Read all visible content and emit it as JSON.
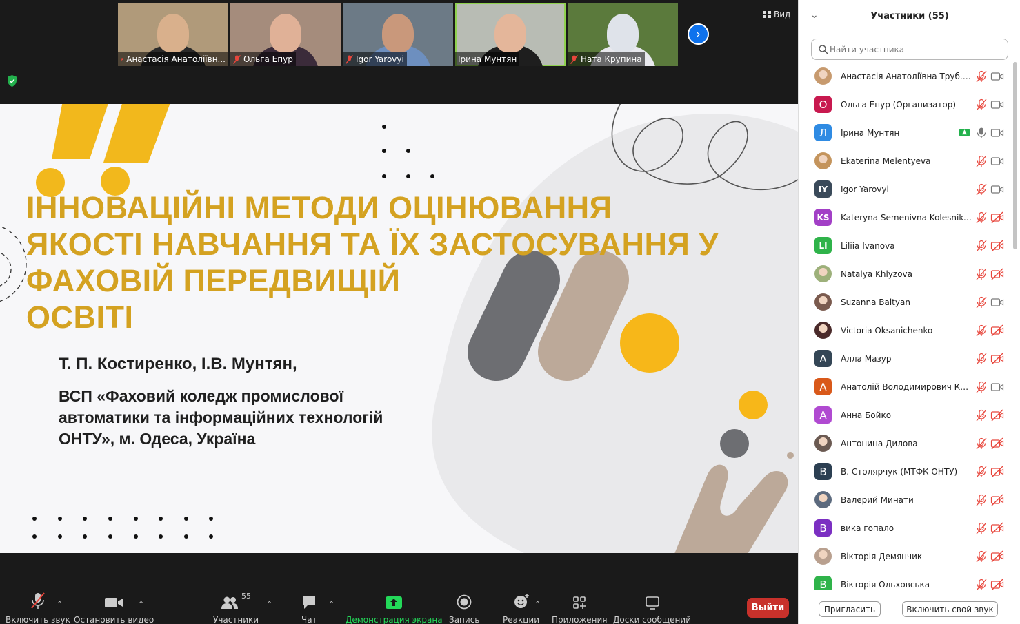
{
  "thumbnails": [
    {
      "name": "Анастасія Анатоліївн...",
      "muted": true,
      "bg": "#b09a7a",
      "face": "#d9b08c",
      "shirt": "#2a2a2a",
      "active": false
    },
    {
      "name": "Ольга Епур",
      "muted": true,
      "bg": "#a58c7c",
      "face": "#e0b197",
      "shirt": "#3b2b3a",
      "active": false
    },
    {
      "name": "Igor Yarovyi",
      "muted": true,
      "bg": "#6c7a86",
      "face": "#c9987b",
      "shirt": "#6d8fbf",
      "active": false
    },
    {
      "name": "Ірина Мунтян",
      "muted": false,
      "bg": "#b8bcb4",
      "face": "#e4b69a",
      "shirt": "#1e1e1e",
      "active": true
    },
    {
      "name": "Ната Крупина",
      "muted": true,
      "bg": "#5b7a3c",
      "face": "#dfe3ea",
      "shirt": "#e9e9ee",
      "active": false
    }
  ],
  "view_label": "Вид",
  "slide": {
    "title": "ІННОВАЦІЙНІ МЕТОДИ ОЦІНЮВАННЯ\nЯКОСТІ НАВЧАННЯ ТА ЇХ ЗАСТОСУВАННЯ У\nФАХОВІЙ ПЕРЕДВИЩІЙ\n ОСВІТІ",
    "authors": "Т. П. Костиренко, І.В. Мунтян,",
    "organization": "ВСП «Фаховий коледж промислової\nавтоматики та інформаційних технологій\nОНТУ», м. Одеса, Україна"
  },
  "toolbar": {
    "mute": "Включить звук",
    "video": "Остановить видео",
    "participants": "Участники",
    "participants_count": "55",
    "chat": "Чат",
    "share": "Демонстрация экрана",
    "record": "Запись",
    "reactions": "Реакции",
    "apps": "Приложения",
    "whiteboards": "Доски сообщений",
    "exit": "Выйти"
  },
  "panel": {
    "title": "Участники (55)",
    "search_placeholder": "Найти участника",
    "invite": "Пригласить",
    "unmute_me": "Включить свой звук",
    "participants": [
      {
        "name": "Анастасія Анатоліївна Труб... (Я)",
        "avatar": "",
        "color": "#c79a6e",
        "photo": true,
        "video_on": true,
        "sharing": false,
        "mic_live": false
      },
      {
        "name": "Ольга Епур (Организатор)",
        "avatar": "О",
        "color": "#c8194f",
        "photo": false,
        "video_on": true,
        "sharing": false,
        "mic_live": false
      },
      {
        "name": "Ірина Мунтян",
        "avatar": "Л",
        "color": "#2f8be3",
        "photo": false,
        "video_on": true,
        "sharing": true,
        "mic_live": true
      },
      {
        "name": "Ekaterina Melentyeva",
        "avatar": "",
        "color": "#c4945c",
        "photo": true,
        "video_on": true,
        "sharing": false,
        "mic_live": false
      },
      {
        "name": "Igor Yarovyi",
        "avatar": "IY",
        "color": "#3a4a5a",
        "photo": false,
        "video_on": true,
        "sharing": false,
        "mic_live": false
      },
      {
        "name": "Kateryna Semenivna Kolesnikova",
        "avatar": "KS",
        "color": "#a23fc6",
        "photo": false,
        "video_on": false,
        "sharing": false,
        "mic_live": false
      },
      {
        "name": "Liliia Ivanova",
        "avatar": "LI",
        "color": "#2fb34a",
        "photo": false,
        "video_on": false,
        "sharing": false,
        "mic_live": false
      },
      {
        "name": "Natalya Khlyzova",
        "avatar": "",
        "color": "#9db07a",
        "photo": true,
        "video_on": false,
        "sharing": false,
        "mic_live": false
      },
      {
        "name": "Suzanna Baltyan",
        "avatar": "",
        "color": "#7a5a4e",
        "photo": true,
        "video_on": true,
        "sharing": false,
        "mic_live": false
      },
      {
        "name": "Victoria Oksanichenko",
        "avatar": "",
        "color": "#4a2a2a",
        "photo": true,
        "video_on": false,
        "sharing": false,
        "mic_live": false
      },
      {
        "name": "Алла Мазур",
        "avatar": "А",
        "color": "#344656",
        "photo": false,
        "video_on": false,
        "sharing": false,
        "mic_live": false
      },
      {
        "name": "Анатолій Володимирович Ков...",
        "avatar": "А",
        "color": "#d9591a",
        "photo": false,
        "video_on": true,
        "sharing": false,
        "mic_live": false
      },
      {
        "name": "Анна Бойко",
        "avatar": "А",
        "color": "#b04ad1",
        "photo": false,
        "video_on": false,
        "sharing": false,
        "mic_live": false
      },
      {
        "name": "Антонина Дилова",
        "avatar": "",
        "color": "#6b5a52",
        "photo": true,
        "video_on": false,
        "sharing": false,
        "mic_live": false
      },
      {
        "name": "В. Столярчук (МТФК ОНТУ)",
        "avatar": "В",
        "color": "#2c3f52",
        "photo": false,
        "video_on": false,
        "sharing": false,
        "mic_live": false
      },
      {
        "name": "Валерий Минати",
        "avatar": "",
        "color": "#5c6a7e",
        "photo": true,
        "video_on": false,
        "sharing": false,
        "mic_live": false
      },
      {
        "name": "вика гопало",
        "avatar": "В",
        "color": "#7b2fc2",
        "photo": false,
        "video_on": false,
        "sharing": false,
        "mic_live": false
      },
      {
        "name": "Вікторія Демянчик",
        "avatar": "",
        "color": "#b9a08f",
        "photo": true,
        "video_on": false,
        "sharing": false,
        "mic_live": false
      },
      {
        "name": "Вікторія Ольховська",
        "avatar": "В",
        "color": "#2fb34a",
        "photo": false,
        "video_on": false,
        "sharing": false,
        "mic_live": false
      }
    ]
  }
}
